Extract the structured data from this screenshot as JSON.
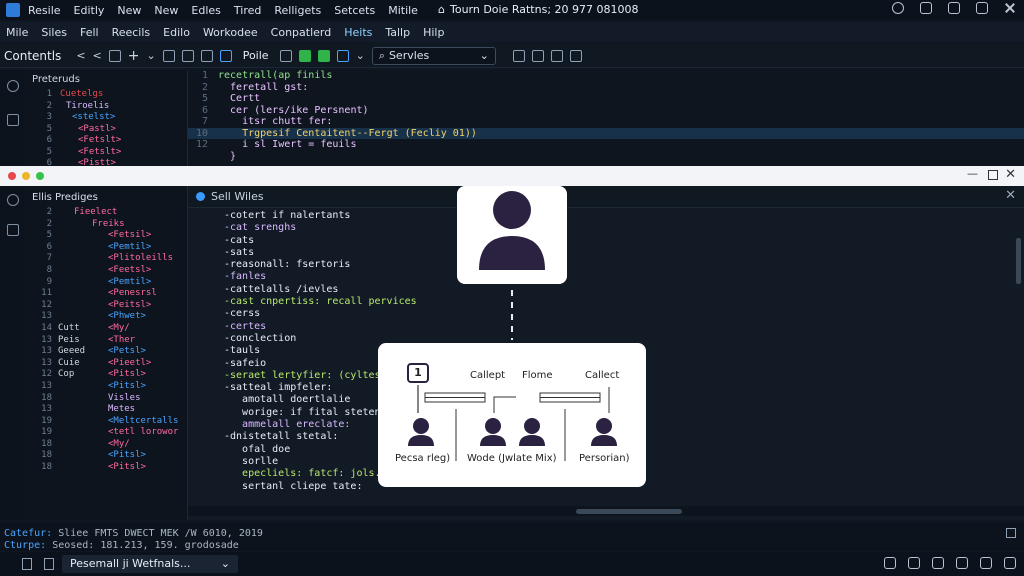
{
  "titlebar": {
    "menu": [
      "Resile",
      "Editly",
      "New",
      "New",
      "Edles",
      "Tired",
      "Relligets",
      "Setcets",
      "Mitile"
    ],
    "center_title": "Tourn Doie Rattns; 20 977 081008"
  },
  "menubar2": [
    "Mile",
    "Siles",
    "Fell",
    "Reecils",
    "Edilo",
    "Workodee",
    "Conpatlerd",
    "Heits",
    "Tallp",
    "Hilp"
  ],
  "toolbar": {
    "label": "Contentls",
    "file": "Poile",
    "search_value": "Servles"
  },
  "back": {
    "panel_title": "Preteruds",
    "tree": [
      {
        "n": "1",
        "t": "Cuetelgs"
      },
      {
        "n": "2",
        "t": "Tiroelis"
      },
      {
        "n": "3",
        "t": "<stelst>"
      },
      {
        "n": "5",
        "t": "<Pastl>"
      },
      {
        "n": "6",
        "t": "<Fetslt>"
      },
      {
        "n": "5",
        "t": "<Fetslt>"
      },
      {
        "n": "6",
        "t": "<Pistt>"
      },
      {
        "n": "7",
        "t": "<iestt>"
      }
    ],
    "code": [
      {
        "n": "1",
        "t": "recetrall(ap finils"
      },
      {
        "n": "2",
        "t": "  feretall gst:"
      },
      {
        "n": "5",
        "t": "  Certt"
      },
      {
        "n": "6",
        "t": "  cer (lers/ike Persnent)"
      },
      {
        "n": "7",
        "t": "    itsr chutt fer:"
      },
      {
        "n": "10",
        "t": "    Trgpesif Centaitent--Fergt (Fecliy 01))"
      },
      {
        "n": "12",
        "t": "    i sl Iwert = feuils"
      },
      {
        "n": "",
        "t": "  }"
      }
    ]
  },
  "front": {
    "panel_title": "Ellis Prediges",
    "tree": [
      {
        "n": "2",
        "a": "",
        "t": "Fieelect"
      },
      {
        "n": "2",
        "a": "",
        "t": "Freiks"
      },
      {
        "n": "5",
        "a": "",
        "t": "<Fetsil>"
      },
      {
        "n": "6",
        "a": "",
        "t": "<Pemtil>"
      },
      {
        "n": "7",
        "a": "",
        "t": "<Plitoleills"
      },
      {
        "n": "8",
        "a": "",
        "t": "<Feetsl>"
      },
      {
        "n": "9",
        "a": "",
        "t": "<Pemtil>"
      },
      {
        "n": "11",
        "a": "",
        "t": "<Penesrsl"
      },
      {
        "n": "12",
        "a": "",
        "t": "<Peitsl>"
      },
      {
        "n": "13",
        "a": "",
        "t": "<Phwet>"
      },
      {
        "n": "14",
        "a": "Cutt",
        "t": "<My/"
      },
      {
        "n": "13",
        "a": "Peis",
        "t": "<Ther"
      },
      {
        "n": "13",
        "a": "Geeed",
        "t": "<Petsl>"
      },
      {
        "n": "13",
        "a": "Cuie",
        "t": "<Pieetl>"
      },
      {
        "n": "12",
        "a": "Cop",
        "t": "<Pitsl>"
      },
      {
        "n": "13",
        "a": "",
        "t": "<Pitsl>"
      },
      {
        "n": "18",
        "a": "",
        "t": "Visles"
      },
      {
        "n": "13",
        "a": "",
        "t": "Metes"
      },
      {
        "n": "19",
        "a": "",
        "t": "<Meltcertalls"
      },
      {
        "n": "19",
        "a": "",
        "t": "<tetl lorowor"
      },
      {
        "n": "18",
        "a": "",
        "t": "<My/"
      },
      {
        "n": "18",
        "a": "",
        "t": "<Pitsl>"
      },
      {
        "n": "18",
        "a": "",
        "t": "<Pitsl>"
      }
    ],
    "tab_title": "Sell Wiles",
    "code": [
      "-cotert if nalertants",
      "-cat srenghs",
      "-cats",
      "-sats",
      "-reasonall: fsertoris",
      "-fanles",
      "-cattelalls /ievles",
      "-cast cnpertiss: recall pervices",
      "-cerss",
      "-certes",
      "-conclection",
      "-tauls",
      "-safeio",
      "-seraet lertyfier: (cyltess /",
      "-satteal impfeler:",
      "   amotall doertlalie",
      "   worige: if fital stetent",
      "   ammelall ereclate:",
      "-dnistetall stetal:",
      "   ofal doe",
      "   sorlle",
      "   epecliels: fatcf: jols.",
      "   sertanl cliepe tate:"
    ]
  },
  "flow": {
    "badge": "1",
    "labels": [
      "Callept",
      "Flome",
      "Callect"
    ],
    "people": [
      "Pecsa rleg)",
      "Wode (Jwlate Mix)",
      "Persorian)"
    ]
  },
  "status": {
    "line1_label": "Catefur:",
    "line1_value": "Sliee   FMTS DWECT MEK /W 6010, 2019",
    "line2_label": "Cturpe:",
    "line2_value": "Seosed: 181.213, 159. grodosade"
  },
  "bottom": {
    "tab_label": "Pesemall ji Wetfnals..."
  }
}
